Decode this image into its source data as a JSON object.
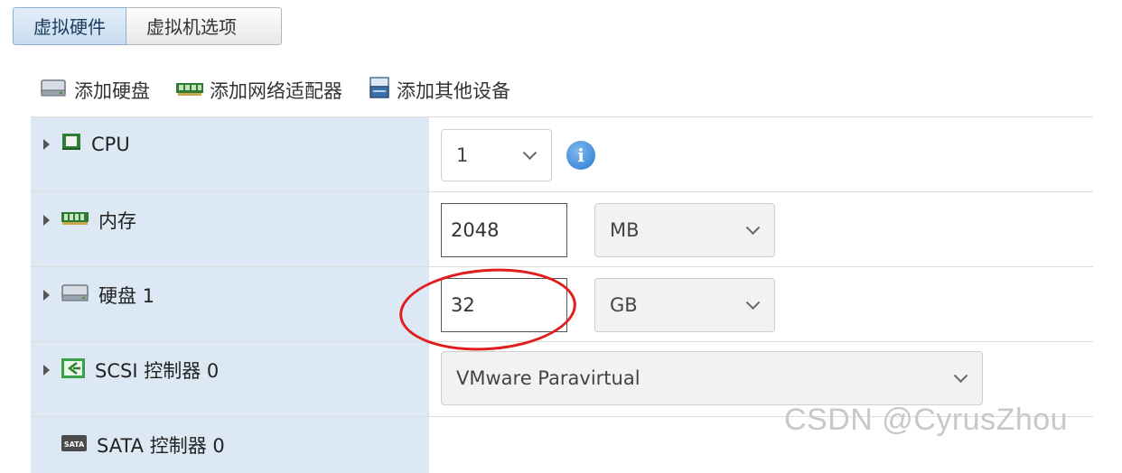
{
  "tabs": [
    {
      "label": "虚拟硬件",
      "active": true
    },
    {
      "label": "虚拟机选项",
      "active": false
    }
  ],
  "toolbar": {
    "add_disk": {
      "label": "添加硬盘",
      "icon": "hard-disk-icon"
    },
    "add_network": {
      "label": "添加网络适配器",
      "icon": "network-adapter-icon"
    },
    "add_other": {
      "label": "添加其他设备",
      "icon": "other-device-icon"
    }
  },
  "hardware": {
    "cpu": {
      "label": "CPU",
      "value": "1",
      "icon": "cpu-icon"
    },
    "memory": {
      "label": "内存",
      "value": "2048",
      "unit": "MB",
      "icon": "memory-icon"
    },
    "disk": {
      "label": "硬盘 1",
      "value": "32",
      "unit": "GB",
      "icon": "hard-disk-icon"
    },
    "scsi": {
      "label": "SCSI 控制器 0",
      "value": "VMware Paravirtual",
      "icon": "scsi-controller-icon"
    },
    "sata": {
      "label": "SATA 控制器 0",
      "icon": "sata-icon",
      "icon_text": "SATA"
    }
  },
  "info_icon_glyph": "i",
  "watermark": "CSDN @CyrusZhou",
  "colors": {
    "label_cell_bg": "#dce9f5",
    "active_tab_bg": "#c9dcf0",
    "highlight_ellipse": "#e01e1e",
    "info_icon": "#2a7ad0"
  }
}
